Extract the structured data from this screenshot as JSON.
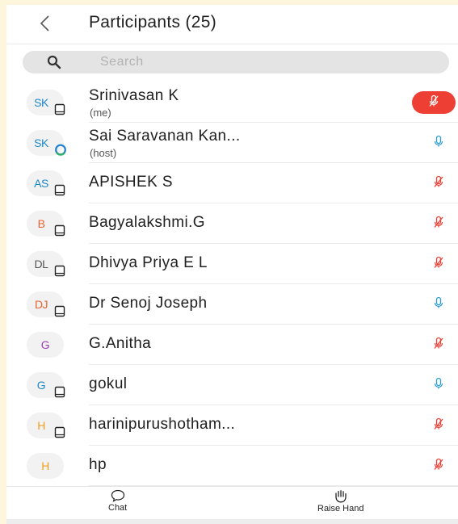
{
  "header": {
    "title": "Participants (25)"
  },
  "search": {
    "placeholder": "Search"
  },
  "colors": {
    "muted_mic": "#ee3f34",
    "unmuted_mic": "#2b9bd6",
    "active_mic_bg": "#ee3f34"
  },
  "participants": [
    {
      "initials": "SK",
      "initials_color": "#1e88c9",
      "name": "Srinivasan K",
      "role": "(me)",
      "device": "phone-icon",
      "mic": "muted-active"
    },
    {
      "initials": "SK",
      "initials_color": "#1e88c9",
      "name": "Sai Saravanan Kan...",
      "role": "(host)",
      "device": "ring-icon",
      "mic": "unmuted"
    },
    {
      "initials": "AS",
      "initials_color": "#1e88c9",
      "name": "APISHEK S",
      "role": "",
      "device": "phone-icon",
      "mic": "muted"
    },
    {
      "initials": "B",
      "initials_color": "#e8622f",
      "name": "Bagyalakshmi.G",
      "role": "",
      "device": "phone-icon",
      "mic": "muted"
    },
    {
      "initials": "DL",
      "initials_color": "#555555",
      "name": "Dhivya Priya E L",
      "role": "",
      "device": "phone-icon",
      "mic": "muted"
    },
    {
      "initials": "DJ",
      "initials_color": "#e8622f",
      "name": "Dr Senoj Joseph",
      "role": "",
      "device": "phone-icon",
      "mic": "unmuted"
    },
    {
      "initials": "G",
      "initials_color": "#9b3fb5",
      "name": "G.Anitha",
      "role": "",
      "device": "",
      "mic": "muted"
    },
    {
      "initials": "G",
      "initials_color": "#1e88c9",
      "name": "gokul",
      "role": "",
      "device": "phone-icon",
      "mic": "unmuted"
    },
    {
      "initials": "H",
      "initials_color": "#f0a020",
      "name": "harinipurushotham...",
      "role": "",
      "device": "phone-icon",
      "mic": "muted"
    },
    {
      "initials": "H",
      "initials_color": "#f0a020",
      "name": "hp",
      "role": "",
      "device": "",
      "mic": "muted"
    }
  ],
  "footer": {
    "chat_label": "Chat",
    "raise_hand_label": "Raise Hand"
  }
}
